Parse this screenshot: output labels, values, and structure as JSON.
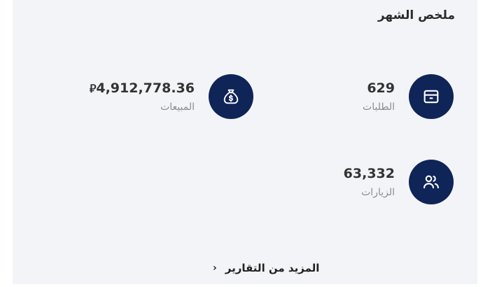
{
  "summary": {
    "title": "ملخص الشهر"
  },
  "stats": {
    "orders": {
      "value": "629",
      "label": "الطلبات",
      "icon": "box-icon"
    },
    "sales": {
      "value": "4,912,778.36",
      "currency": "⃁",
      "label": "المبيعات",
      "icon": "money-bag-icon"
    },
    "visits": {
      "value": "63,332",
      "label": "الزيارات",
      "icon": "users-icon"
    }
  },
  "more_reports": {
    "label": "المزيد من التقارير",
    "chevron": "›"
  },
  "colors": {
    "icon_circle": "#0f2457",
    "card_bg": "#f3f4f7"
  }
}
